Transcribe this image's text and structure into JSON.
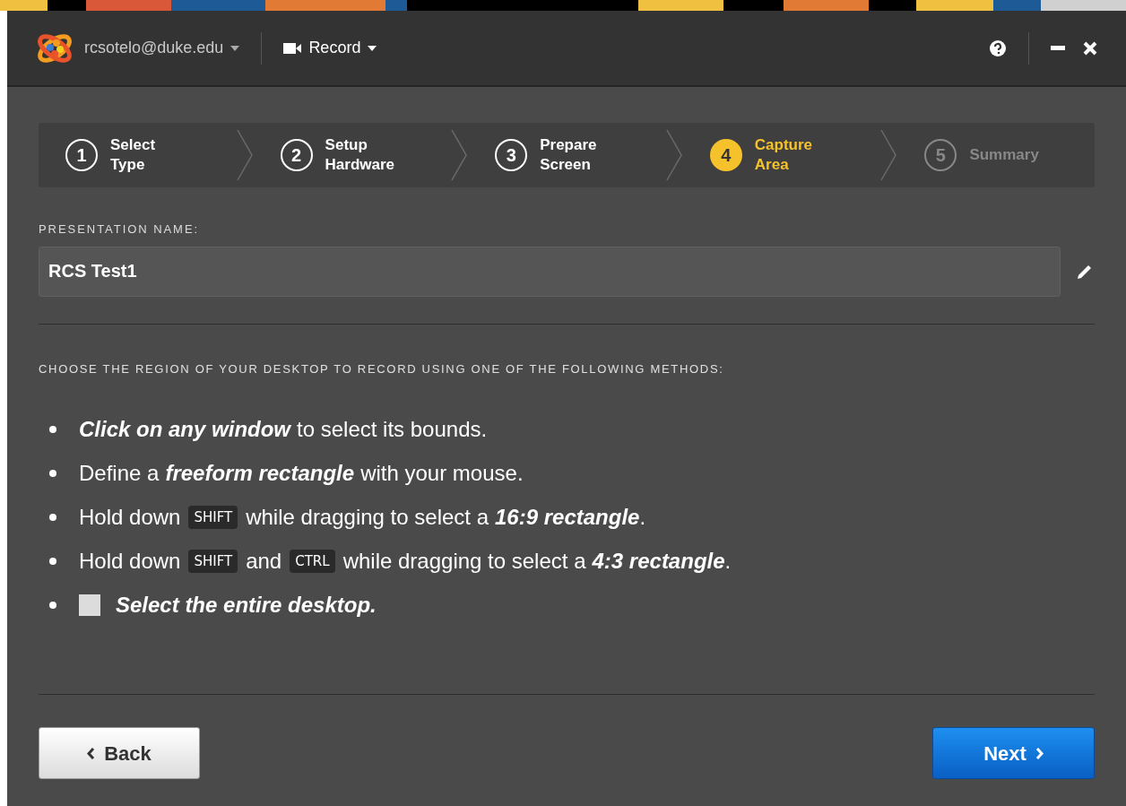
{
  "title_bar": {
    "account": "rcsotelo@duke.edu",
    "mode": "Record"
  },
  "steps": [
    {
      "number": "1",
      "label": "Select Type",
      "selected": false,
      "disabled": false
    },
    {
      "number": "2",
      "label": "Setup Hardware",
      "selected": false,
      "disabled": false
    },
    {
      "number": "3",
      "label": "Prepare Screen",
      "selected": false,
      "disabled": false
    },
    {
      "number": "4",
      "label": "Capture Area",
      "selected": true,
      "disabled": false
    },
    {
      "number": "5",
      "label": "Summary",
      "selected": false,
      "disabled": true
    }
  ],
  "name_field": {
    "label": "PRESENTATION NAME:",
    "value": "RCS Test1"
  },
  "instructions": "CHOOSE THE REGION OF YOUR DESKTOP TO RECORD USING ONE OF THE FOLLOWING METHODS:",
  "methods": [
    {
      "parts": [
        {
          "kind": "emph",
          "text": "Click on any window"
        },
        {
          "kind": "text",
          "text": "to select its bounds."
        }
      ]
    },
    {
      "parts": [
        {
          "kind": "text",
          "text": "Define a"
        },
        {
          "kind": "emph",
          "text": "freeform rectangle"
        },
        {
          "kind": "text",
          "text": "with your mouse."
        }
      ]
    },
    {
      "parts": [
        {
          "kind": "text",
          "text": "Hold down"
        },
        {
          "kind": "key",
          "text": "SHIFT"
        },
        {
          "kind": "text",
          "text": "while dragging to select a"
        },
        {
          "kind": "emph",
          "text": "16:9 rectangle"
        },
        {
          "kind": "text",
          "text": ".",
          "space_before": false
        }
      ]
    },
    {
      "parts": [
        {
          "kind": "text",
          "text": "Hold down"
        },
        {
          "kind": "key",
          "text": "SHIFT"
        },
        {
          "kind": "text",
          "text": "and"
        },
        {
          "kind": "key",
          "text": "CTRL"
        },
        {
          "kind": "text",
          "text": "while dragging to select a"
        },
        {
          "kind": "emph",
          "text": "4:3 rectangle"
        },
        {
          "kind": "text",
          "text": ".",
          "space_before": false
        }
      ]
    },
    {
      "parts": [
        {
          "kind": "checkbox",
          "checked": false
        },
        {
          "kind": "emph",
          "text": "Select the entire desktop."
        }
      ]
    }
  ],
  "buttons": {
    "back": "Back",
    "next": "Next"
  }
}
